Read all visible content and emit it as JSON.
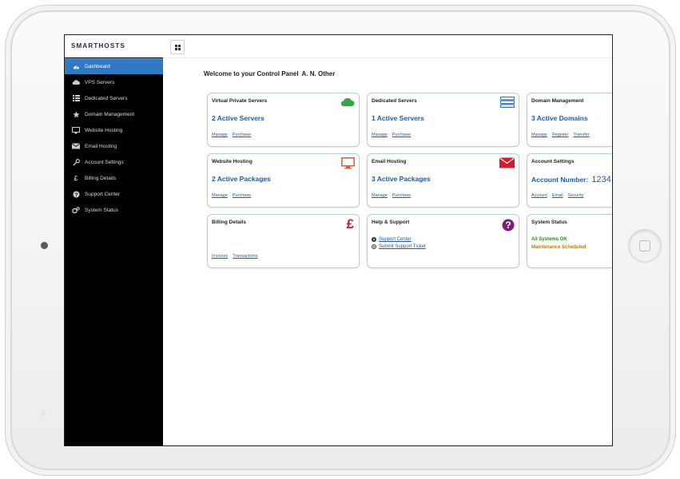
{
  "brand": {
    "logo": "SMARTHOSTS"
  },
  "sidebar": {
    "items": [
      {
        "label": "Dashboard",
        "icon": "dashboard-icon",
        "active": true
      },
      {
        "label": "VPS Servers",
        "icon": "cloud-icon"
      },
      {
        "label": "Dedicated Servers",
        "icon": "server-list-icon"
      },
      {
        "label": "Domain Management",
        "icon": "star-icon"
      },
      {
        "label": "Website Hosting",
        "icon": "monitor-icon"
      },
      {
        "label": "Email Hosting",
        "icon": "envelope-icon"
      },
      {
        "label": "Account Settings",
        "icon": "wrench-icon"
      },
      {
        "label": "Billing Details",
        "icon": "pound-icon"
      },
      {
        "label": "Support Center",
        "icon": "question-icon"
      },
      {
        "label": "System Status",
        "icon": "gears-icon"
      }
    ]
  },
  "main": {
    "welcome": "Welcome to your Control Panel",
    "user_name": "A. N. Other",
    "cards": {
      "vps": {
        "title": "Virtual Private Servers",
        "value": "2 Active Servers",
        "links": [
          "Manage",
          "Purchase"
        ],
        "icon": "cloud-icon",
        "color": "#3aa24a"
      },
      "dedicated": {
        "title": "Dedicated Servers",
        "value": "1 Active Servers",
        "links": [
          "Manage",
          "Purchase"
        ],
        "icon": "server-stack-icon",
        "color": "#2f78c4"
      },
      "domain": {
        "title": "Domain Management",
        "value": "3 Active Domains",
        "links": [
          "Manage",
          "Register",
          "Transfer"
        ]
      },
      "website": {
        "title": "Website Hosting",
        "value": "2 Active Packages",
        "links": [
          "Manage",
          "Purchase"
        ],
        "icon": "monitor-icon",
        "color": "#e4572e"
      },
      "email": {
        "title": "Email Hosting",
        "value": "3 Active Packages",
        "links": [
          "Manage",
          "Purchase"
        ],
        "icon": "envelope-icon",
        "color": "#d8192b"
      },
      "account": {
        "title": "Account Settings",
        "label": "Account Number:",
        "number": "1234",
        "links": [
          "Account",
          "Email",
          "Security"
        ]
      },
      "billing": {
        "title": "Billing Details",
        "icon_glyph": "£",
        "links": [
          "Invoices",
          "Transactions"
        ],
        "color": "#d8192b"
      },
      "support": {
        "title": "Help & Support",
        "icon_glyph": "?",
        "links": [
          "Support Center",
          "Submit Support Ticket"
        ],
        "color": "#7b1f7a"
      },
      "status": {
        "title": "System Status",
        "ok": "All Systems OK",
        "maintenance": "Maintenance Scheduled",
        "ok_color": "#2a8a1d",
        "maint_color": "#c07a00"
      }
    }
  }
}
